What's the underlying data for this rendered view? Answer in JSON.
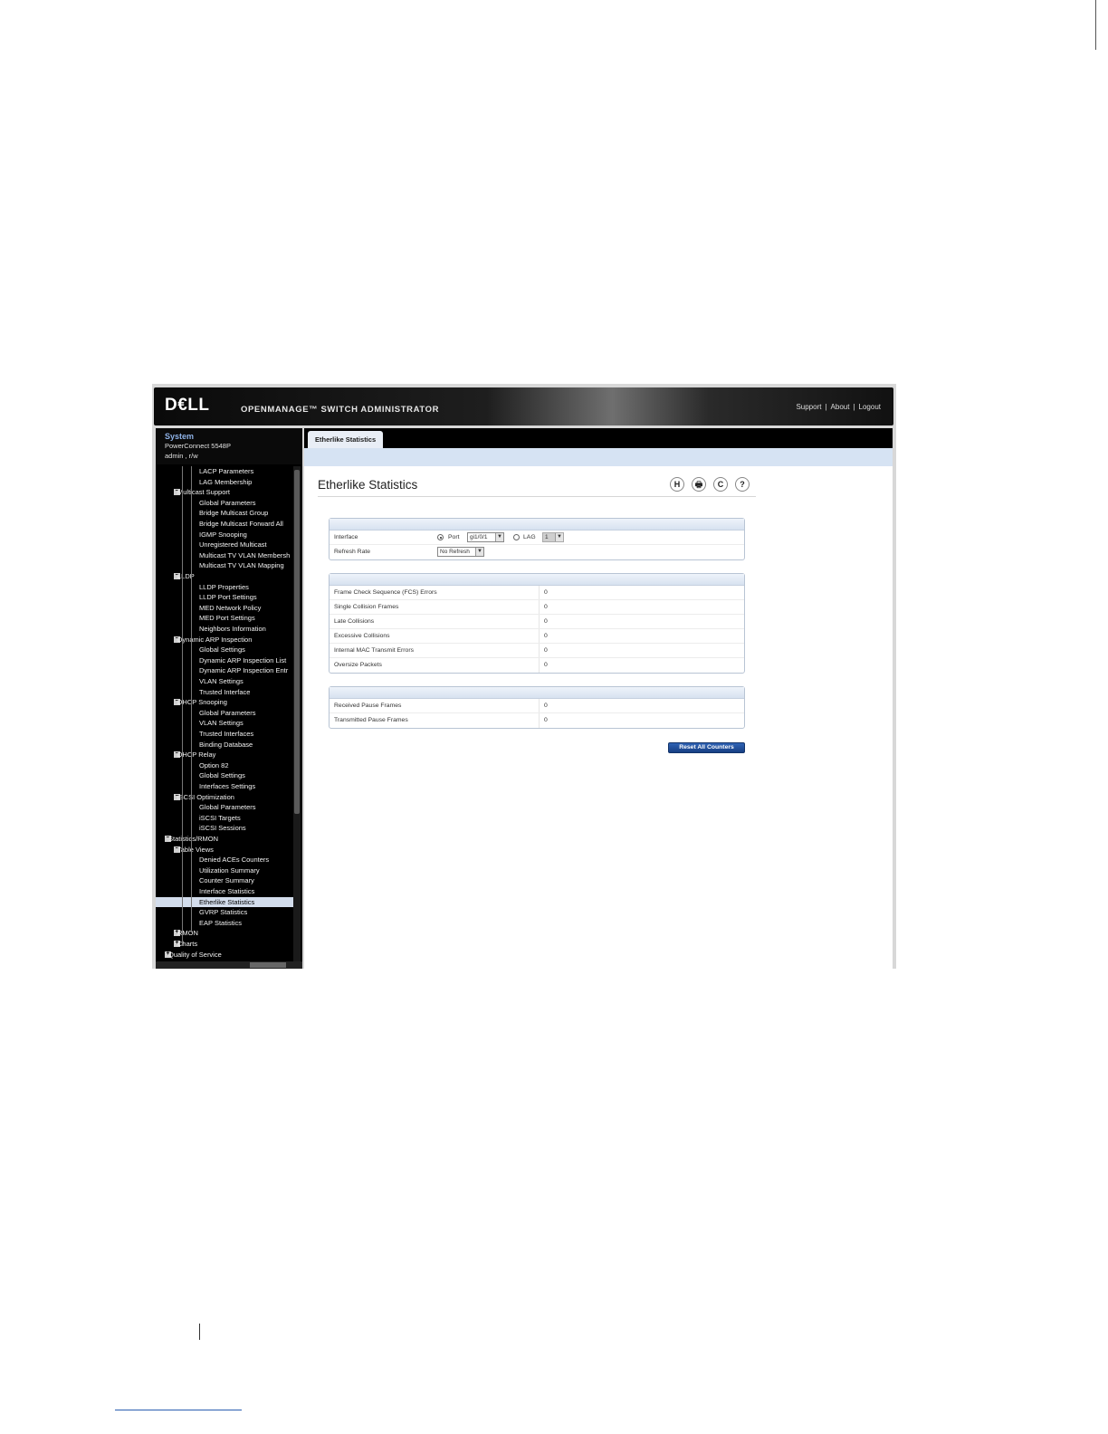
{
  "header": {
    "logo": "D€LL",
    "title": "OPENMANAGE™ SWITCH ADMINISTRATOR",
    "links": [
      "Support",
      "About",
      "Logout"
    ],
    "separator": "|"
  },
  "system": {
    "title": "System",
    "model": "PowerConnect 5548P",
    "user": "admin , r/w"
  },
  "tree": [
    {
      "label": "LACP Parameters",
      "level": 3
    },
    {
      "label": "LAG Membership",
      "level": 3
    },
    {
      "label": "Multicast Support",
      "level": 2,
      "toggle": "−"
    },
    {
      "label": "Global Parameters",
      "level": 3
    },
    {
      "label": "Bridge Multicast Group",
      "level": 3
    },
    {
      "label": "Bridge Multicast Forward All",
      "level": 3
    },
    {
      "label": "IGMP Snooping",
      "level": 3
    },
    {
      "label": "Unregistered Multicast",
      "level": 3
    },
    {
      "label": "Multicast TV VLAN Membersh",
      "level": 3
    },
    {
      "label": "Multicast TV VLAN Mapping",
      "level": 3
    },
    {
      "label": "LLDP",
      "level": 2,
      "toggle": "−"
    },
    {
      "label": "LLDP Properties",
      "level": 3
    },
    {
      "label": "LLDP Port Settings",
      "level": 3
    },
    {
      "label": "MED Network Policy",
      "level": 3
    },
    {
      "label": "MED Port Settings",
      "level": 3
    },
    {
      "label": "Neighbors Information",
      "level": 3
    },
    {
      "label": "Dynamic ARP Inspection",
      "level": 2,
      "toggle": "−"
    },
    {
      "label": "Global Settings",
      "level": 3
    },
    {
      "label": "Dynamic ARP Inspection List",
      "level": 3
    },
    {
      "label": "Dynamic ARP Inspection Entr",
      "level": 3
    },
    {
      "label": "VLAN Settings",
      "level": 3
    },
    {
      "label": "Trusted Interface",
      "level": 3
    },
    {
      "label": "DHCP Snooping",
      "level": 2,
      "toggle": "−"
    },
    {
      "label": "Global Parameters",
      "level": 3
    },
    {
      "label": "VLAN Settings",
      "level": 3
    },
    {
      "label": "Trusted Interfaces",
      "level": 3
    },
    {
      "label": "Binding Database",
      "level": 3
    },
    {
      "label": "DHCP Relay",
      "level": 2,
      "toggle": "−"
    },
    {
      "label": "Option 82",
      "level": 3
    },
    {
      "label": "Global Settings",
      "level": 3
    },
    {
      "label": "Interfaces Settings",
      "level": 3
    },
    {
      "label": "iSCSI Optimization",
      "level": 2,
      "toggle": "−"
    },
    {
      "label": "Global Parameters",
      "level": 3
    },
    {
      "label": "iSCSI Targets",
      "level": 3
    },
    {
      "label": "iSCSI Sessions",
      "level": 3
    },
    {
      "label": "Statistics/RMON",
      "level": 1,
      "toggle": "−"
    },
    {
      "label": "Table Views",
      "level": 2,
      "toggle": "−"
    },
    {
      "label": "Denied ACEs Counters",
      "level": 3
    },
    {
      "label": "Utilization Summary",
      "level": 3
    },
    {
      "label": "Counter Summary",
      "level": 3
    },
    {
      "label": "Interface Statistics",
      "level": 3
    },
    {
      "label": "Etherlike Statistics",
      "level": 3,
      "selected": true
    },
    {
      "label": "GVRP Statistics",
      "level": 3
    },
    {
      "label": "EAP Statistics",
      "level": 3
    },
    {
      "label": "RMON",
      "level": 2,
      "toggle": "+"
    },
    {
      "label": "Charts",
      "level": 2,
      "toggle": "+"
    },
    {
      "label": "Quality of Service",
      "level": 1,
      "toggle": "+"
    }
  ],
  "tab": "Etherlike Statistics",
  "page_title": "Etherlike Statistics",
  "toolbar": {
    "save": "H",
    "print": "🖶",
    "refresh": "C",
    "help": "?"
  },
  "form": {
    "interface_label": "Interface",
    "port_label": "Port",
    "port_value": "gi1/0/1",
    "lag_label": "LAG",
    "lag_value": "1",
    "refresh_label": "Refresh Rate",
    "refresh_value": "No Refresh",
    "arrow": "▼"
  },
  "errors": [
    {
      "label": "Frame Check Sequence (FCS) Errors",
      "value": "0"
    },
    {
      "label": "Single Collision Frames",
      "value": "0"
    },
    {
      "label": "Late Collisions",
      "value": "0"
    },
    {
      "label": "Excessive Collisions",
      "value": "0"
    },
    {
      "label": "Internal MAC Transmit Errors",
      "value": "0"
    },
    {
      "label": "Oversize Packets",
      "value": "0"
    }
  ],
  "pause": [
    {
      "label": "Received Pause Frames",
      "value": "0"
    },
    {
      "label": "Transmitted Pause Frames",
      "value": "0"
    }
  ],
  "reset_button": "Reset All Counters"
}
